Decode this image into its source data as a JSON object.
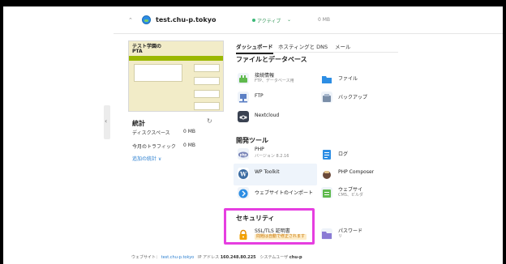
{
  "domain": {
    "name": "test.chu-p.tokyo",
    "status": "アクティブ",
    "size": "0 MB"
  },
  "preview": {
    "title_line1": "テスト学園の",
    "title_line2": "PTA"
  },
  "stats": {
    "title": "統計",
    "disk_label": "ディスクスペース",
    "disk_value": "0 MB",
    "traffic_label": "今月のトラフィック",
    "traffic_value": "0 MB",
    "more_link": "追加の統計 ∨"
  },
  "tabs": [
    {
      "label": "ダッシュボード",
      "active": true
    },
    {
      "label": "ホスティングと DNS",
      "active": false
    },
    {
      "label": "メール",
      "active": false
    }
  ],
  "sections": {
    "files_db": "ファイルとデータベース",
    "dev_tools": "開発ツール",
    "security": "セキュリティ"
  },
  "tools": {
    "connection": {
      "name": "接続情報",
      "sub": "FTP、データベース用"
    },
    "files": {
      "name": "ファイル"
    },
    "ftp": {
      "name": "FTP"
    },
    "backup": {
      "name": "バックアップ"
    },
    "nextcloud": {
      "name": "Nextcloud"
    },
    "php": {
      "name": "PHP",
      "sub": "バージョン 8.2.16"
    },
    "logs": {
      "name": "ログ"
    },
    "wp_toolkit": {
      "name": "WP Toolkit"
    },
    "php_composer": {
      "name": "PHP Composer"
    },
    "website_import": {
      "name": "ウェブサイトのインポート"
    },
    "site_builder": {
      "name": "ウェブサイ",
      "sub": "CMS、ビルダ"
    },
    "ssl": {
      "name": "SSL/TLS 証明書",
      "badge": "問題は自動で修正されます"
    },
    "password": {
      "name": "パスワード",
      "sub": "リ"
    }
  },
  "footer": {
    "site_label": "ウェブサイト：",
    "site_link": "test.chu-p.tokyo",
    "ip_label": "IP アドレス",
    "ip_value": "160.248.80.225",
    "user_label": "システムユーザ",
    "user_value": "chu-p"
  },
  "colors": {
    "active_status": "#3cb878",
    "link": "#2b7fd0",
    "highlight": "#e63ee0",
    "warning_bg": "#fdecc8",
    "warning_text": "#c87400"
  }
}
